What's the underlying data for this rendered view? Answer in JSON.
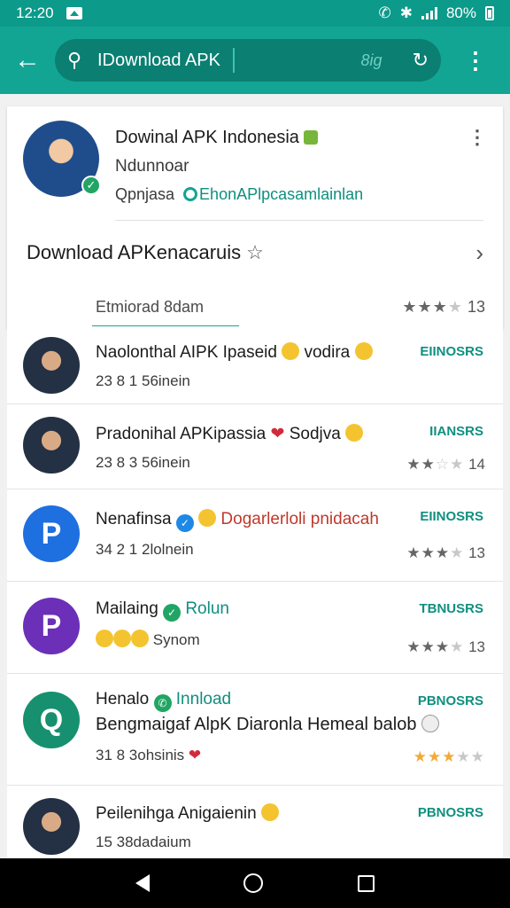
{
  "status_bar": {
    "time": "12:20",
    "battery": "80%"
  },
  "app_bar": {
    "search_value": "IDownload APK",
    "search_hint": "8ig"
  },
  "profile": {
    "title": "Dowinal APK Indonesia",
    "subtitle": "Ndunnoar",
    "meta_left": "Qpnjasa",
    "meta_link": "EhonAPlpcasamlainlan"
  },
  "download_row": {
    "label": "Download APKenacaruis"
  },
  "tab": {
    "label": "Etmiorad 8dam",
    "rating": "13"
  },
  "colors": {
    "accent": "#13a594",
    "accent_dark": "#0a7f72",
    "status_bar": "#0c9a8a",
    "tag_text": "#0f8f7f"
  },
  "items": [
    {
      "title": "Naolonthal AIPK Ipaseid",
      "extra": "vodira",
      "meta": "23  8  1 56inein",
      "tag": "EIINOSRS",
      "rating": ""
    },
    {
      "title": "Pradonihal APKipassia",
      "extra": "Sodjva",
      "meta": "23  8  3 56inein",
      "tag": "IIANSRS",
      "rating": "14"
    },
    {
      "title": "Nenafinsa",
      "link": "Dogarlerloli pnidacah",
      "meta": "34  2  1 2lolnein",
      "tag": "EIINOSRS",
      "rating": "13"
    },
    {
      "title": "Mailaing",
      "link": "Rolun",
      "meta": "Synom",
      "tag": "TBNUSRS",
      "rating": "13"
    },
    {
      "title": "Henalo",
      "link": "Innload",
      "line2": "Bengmaigaf AlpK Diaronla Hemeal balob",
      "meta": "31  8  3ohsinis",
      "tag": "PBNOSRS",
      "rating": ""
    },
    {
      "title": "Peilenihga Anigaienin",
      "meta": "15  38dadaium",
      "tag": "PBNOSRS",
      "rating": ""
    }
  ]
}
